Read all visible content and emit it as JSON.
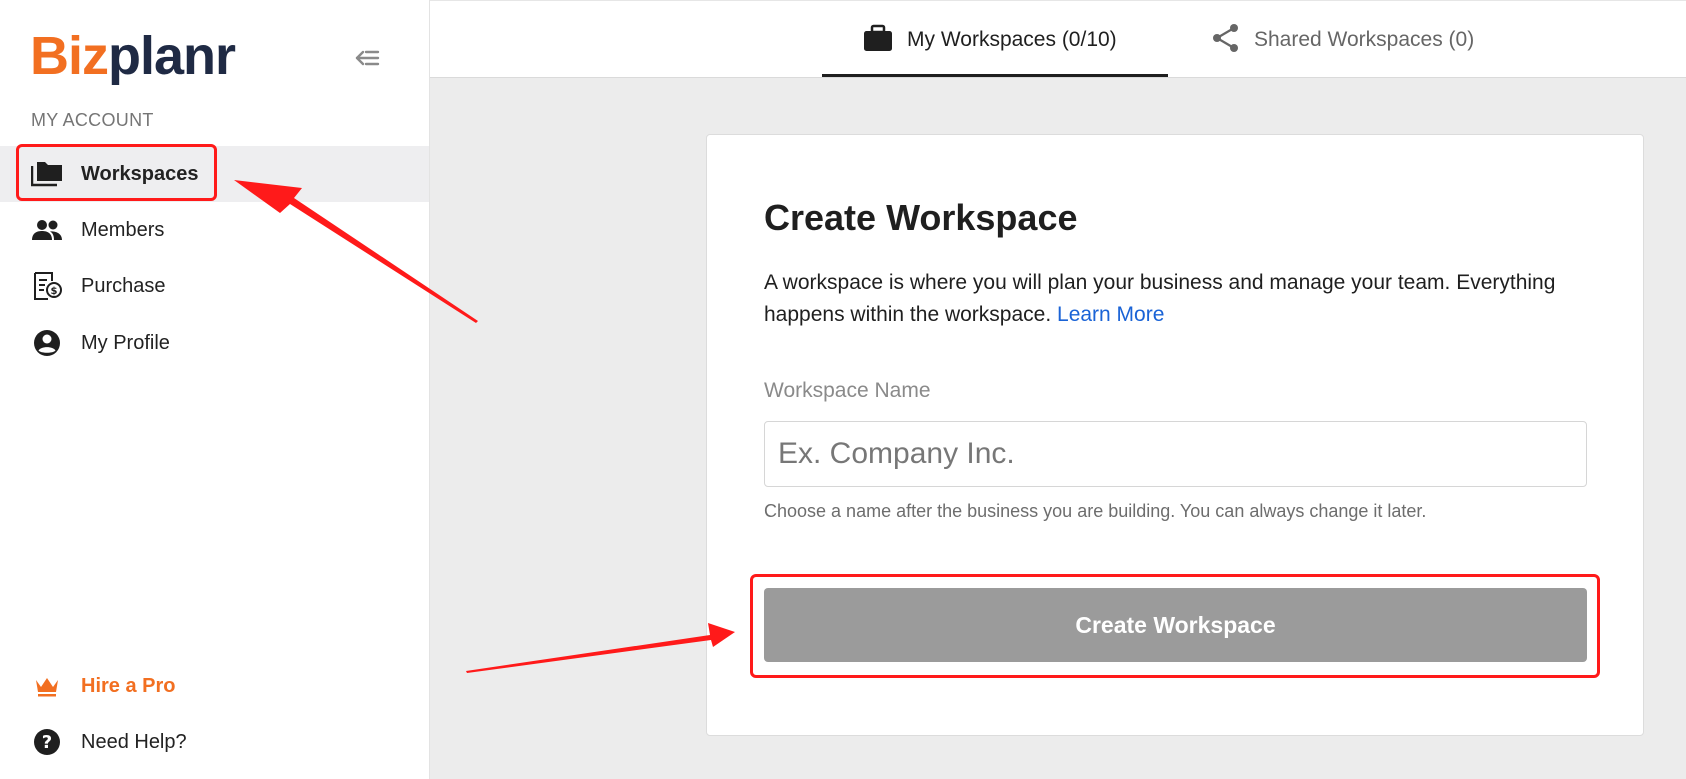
{
  "app": {
    "logo_part1": "Biz",
    "logo_part2": "planr",
    "brand_color": "#f26f21"
  },
  "sidebar": {
    "section_label": "MY ACCOUNT",
    "items": [
      {
        "label": "Workspaces",
        "icon": "folder-icon",
        "active": true
      },
      {
        "label": "Members",
        "icon": "people-icon"
      },
      {
        "label": "Purchase",
        "icon": "receipt-icon"
      },
      {
        "label": "My Profile",
        "icon": "account-circle-icon"
      }
    ],
    "bottom_items": [
      {
        "label": "Hire a Pro",
        "icon": "crown-icon"
      },
      {
        "label": "Need Help?",
        "icon": "help-icon"
      }
    ]
  },
  "tabs": [
    {
      "label": "My Workspaces (0/10)",
      "icon": "briefcase-icon",
      "active": true
    },
    {
      "label": "Shared Workspaces (0)",
      "icon": "share-icon",
      "active": false
    }
  ],
  "card": {
    "title": "Create Workspace",
    "description": "A workspace is where you will plan your business and manage your team. Everything happens within the workspace.",
    "learn_more": "Learn More",
    "field_label": "Workspace Name",
    "input_placeholder": "Ex. Company Inc.",
    "input_value": "",
    "help_text": "Choose a name after the business you are building. You can always change it later.",
    "button_label": "Create Workspace"
  },
  "annotations": {
    "color": "#ff1a1a"
  }
}
